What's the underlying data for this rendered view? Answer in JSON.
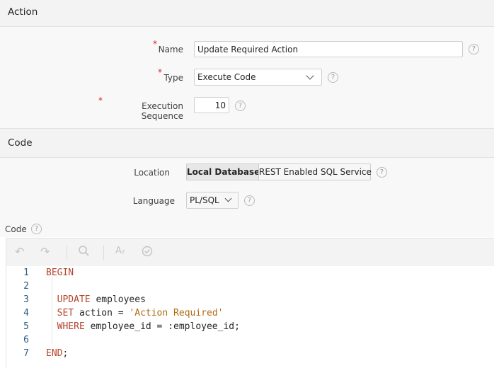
{
  "action_section": {
    "title": "Action",
    "name": {
      "label": "Name",
      "value": "Update Required Action"
    },
    "type": {
      "label": "Type",
      "value": "Execute Code"
    },
    "sequence": {
      "label": "Execution Sequence",
      "value": "10"
    },
    "required_marker": "*"
  },
  "code_section": {
    "title": "Code",
    "location": {
      "label": "Location",
      "options": [
        "Local Database",
        "REST Enabled SQL Service"
      ],
      "selected": "Local Database"
    },
    "language": {
      "label": "Language",
      "value": "PL/SQL"
    },
    "code_label": "Code"
  },
  "help_glyph": "?",
  "icons": [
    "undo-icon",
    "redo-icon",
    "search-icon",
    "text-case-icon",
    "check-circle-icon"
  ],
  "editor": {
    "lines": [
      {
        "num": "1",
        "parts": [
          {
            "t": "BEGIN",
            "k": "kw"
          }
        ]
      },
      {
        "num": "2",
        "parts": []
      },
      {
        "num": "3",
        "parts": [
          {
            "t": "  "
          },
          {
            "t": "UPDATE",
            "k": "kw"
          },
          {
            "t": " employees"
          }
        ]
      },
      {
        "num": "4",
        "parts": [
          {
            "t": "  "
          },
          {
            "t": "SET",
            "k": "kw"
          },
          {
            "t": " action = "
          },
          {
            "t": "'Action Required'",
            "k": "str"
          }
        ]
      },
      {
        "num": "5",
        "parts": [
          {
            "t": "  "
          },
          {
            "t": "WHERE",
            "k": "kw"
          },
          {
            "t": " employee_id = :employee_id;"
          }
        ]
      },
      {
        "num": "6",
        "parts": []
      },
      {
        "num": "7",
        "parts": [
          {
            "t": "END",
            "k": "kw"
          },
          {
            "t": ";"
          }
        ]
      }
    ]
  }
}
